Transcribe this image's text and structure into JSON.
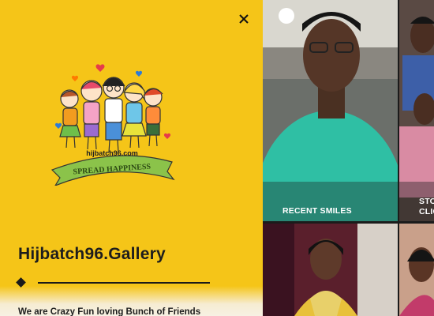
{
  "menu": {
    "close_icon": "close-icon",
    "logo": {
      "url_text": "hijbatch96.com",
      "banner_text": "SPREAD HAPPINESS"
    },
    "title": "Hijbatch96.Gallery",
    "tagline": "We are Crazy Fun loving Bunch of Friends"
  },
  "gallery": {
    "tiles": [
      {
        "label": "RECENT SMILES"
      },
      {
        "label_line1": "STO",
        "label_line2": "CLIC"
      }
    ]
  },
  "colors": {
    "accent": "#f5c518",
    "text": "#1d1d1d"
  }
}
